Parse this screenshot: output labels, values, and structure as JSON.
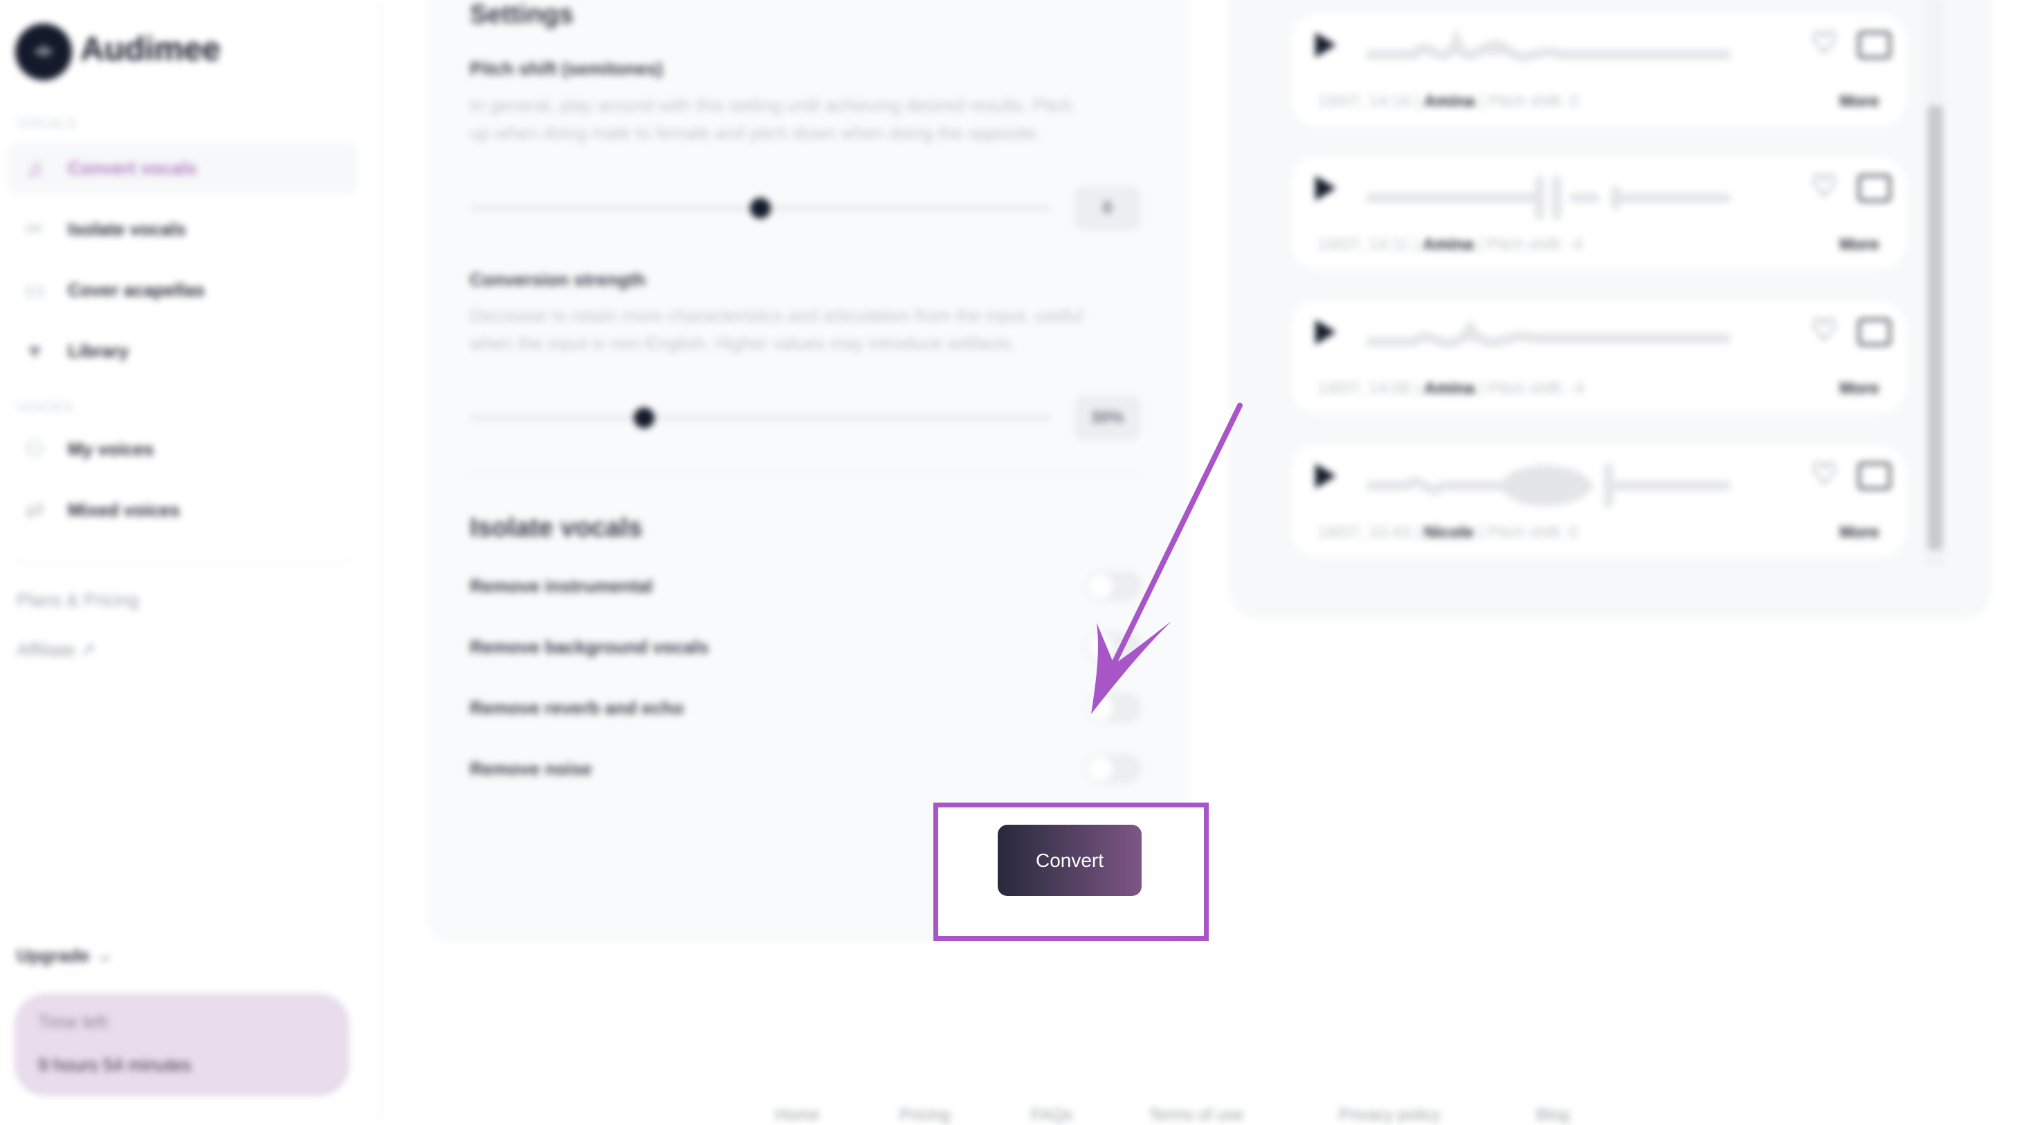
{
  "app": {
    "name": "Audimee"
  },
  "sidebar": {
    "sections": [
      {
        "title": "VOCALS",
        "items": [
          {
            "label": "Convert vocals",
            "icon": "music-note-icon",
            "active": true
          },
          {
            "label": "Isolate vocals",
            "icon": "scissors-icon"
          },
          {
            "label": "Cover acapellas",
            "icon": "folder-play-icon"
          },
          {
            "label": "Library",
            "icon": "heart-icon"
          }
        ]
      },
      {
        "title": "VOICES",
        "items": [
          {
            "label": "My voices",
            "icon": "users-icon"
          },
          {
            "label": "Mixed voices",
            "icon": "shuffle-icon"
          }
        ]
      }
    ],
    "links": {
      "plans": "Plans & Pricing",
      "affiliate": "Affiliate"
    },
    "upgrade": "Upgrade →",
    "time_left": {
      "label": "Time left:",
      "value": "9 hours 54 minutes"
    }
  },
  "settings": {
    "title": "Settings",
    "pitch": {
      "label": "Pitch shift (semitones)",
      "description": "In general, play around with this setting until achieving desired results. Pitch up when doing male to female and pitch down when doing the opposite.",
      "value": "0",
      "slider_fraction": 0.5
    },
    "strength": {
      "label": "Conversion strength",
      "description": "Decrease to retain more characteristics and articulation from the input, useful when the input is non-English. Higher values may introduce artifacts.",
      "value": "30%",
      "slider_fraction": 0.3
    },
    "isolate": {
      "title": "Isolate vocals",
      "options": [
        {
          "label": "Remove instrumental",
          "on": false
        },
        {
          "label": "Remove background vocals",
          "on": false
        },
        {
          "label": "Remove reverb and echo",
          "on": false
        },
        {
          "label": "Remove noise",
          "on": false
        }
      ]
    },
    "convert_label": "Convert"
  },
  "results": [
    {
      "date": "19/07, 14:16",
      "voice": "Amina",
      "pitch": "Pitch shift: 0",
      "more": "More"
    },
    {
      "date": "19/07, 14:11",
      "voice": "Amina",
      "pitch": "Pitch shift: -4",
      "more": "More"
    },
    {
      "date": "19/07, 14:08",
      "voice": "Amina",
      "pitch": "Pitch shift: -4",
      "more": "More"
    },
    {
      "date": "18/07, 10:43",
      "voice": "Nicole",
      "pitch": "Pitch shift: 0",
      "more": "More"
    }
  ],
  "footer": [
    "Home",
    "Pricing",
    "FAQs",
    "Terms of use",
    "Privacy policy",
    "Blog"
  ],
  "colors": {
    "accent": "#a855c8",
    "button_start": "#262a3a",
    "button_end": "#7e5686",
    "time_box": "#e9dded"
  }
}
